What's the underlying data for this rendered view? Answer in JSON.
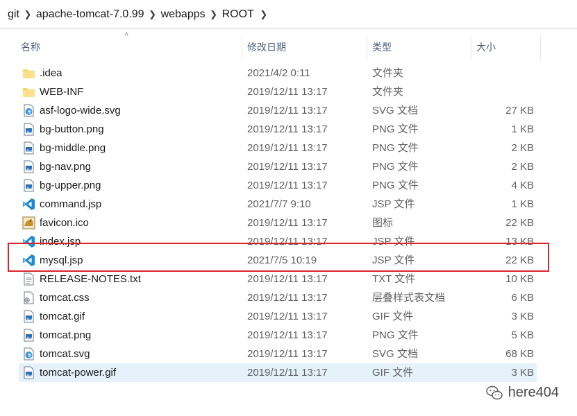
{
  "breadcrumb": [
    "git",
    "apache-tomcat-7.0.99",
    "webapps",
    "ROOT"
  ],
  "columns": {
    "name": "名称",
    "date": "修改日期",
    "type": "类型",
    "size": "大小"
  },
  "files": [
    {
      "name": ".idea",
      "date": "2021/4/2 0:11",
      "type": "文件夹",
      "size": "",
      "icon": "folder-icon"
    },
    {
      "name": "WEB-INF",
      "date": "2019/12/11 13:17",
      "type": "文件夹",
      "size": "",
      "icon": "folder-icon"
    },
    {
      "name": "asf-logo-wide.svg",
      "date": "2019/12/11 13:17",
      "type": "SVG 文档",
      "size": "27 KB",
      "icon": "svg-edge-icon"
    },
    {
      "name": "bg-button.png",
      "date": "2019/12/11 13:17",
      "type": "PNG 文件",
      "size": "1 KB",
      "icon": "image-file-icon"
    },
    {
      "name": "bg-middle.png",
      "date": "2019/12/11 13:17",
      "type": "PNG 文件",
      "size": "2 KB",
      "icon": "image-file-icon"
    },
    {
      "name": "bg-nav.png",
      "date": "2019/12/11 13:17",
      "type": "PNG 文件",
      "size": "2 KB",
      "icon": "image-file-icon"
    },
    {
      "name": "bg-upper.png",
      "date": "2019/12/11 13:17",
      "type": "PNG 文件",
      "size": "4 KB",
      "icon": "image-file-icon"
    },
    {
      "name": "command.jsp",
      "date": "2021/7/7 9:10",
      "type": "JSP 文件",
      "size": "1 KB",
      "icon": "vscode-icon"
    },
    {
      "name": "favicon.ico",
      "date": "2019/12/11 13:17",
      "type": "图标",
      "size": "22 KB",
      "icon": "tomcat-favicon-icon"
    },
    {
      "name": "index.jsp",
      "date": "2019/12/11 13:17",
      "type": "JSP 文件",
      "size": "13 KB",
      "icon": "vscode-icon"
    },
    {
      "name": "mysql.jsp",
      "date": "2021/7/5 10:19",
      "type": "JSP 文件",
      "size": "22 KB",
      "icon": "vscode-icon"
    },
    {
      "name": "RELEASE-NOTES.txt",
      "date": "2019/12/11 13:17",
      "type": "TXT 文件",
      "size": "10 KB",
      "icon": "text-file-icon"
    },
    {
      "name": "tomcat.css",
      "date": "2019/12/11 13:17",
      "type": "层叠样式表文档",
      "size": "6 KB",
      "icon": "css-file-icon"
    },
    {
      "name": "tomcat.gif",
      "date": "2019/12/11 13:17",
      "type": "GIF 文件",
      "size": "3 KB",
      "icon": "image-file-icon"
    },
    {
      "name": "tomcat.png",
      "date": "2019/12/11 13:17",
      "type": "PNG 文件",
      "size": "5 KB",
      "icon": "image-file-icon"
    },
    {
      "name": "tomcat.svg",
      "date": "2019/12/11 13:17",
      "type": "SVG 文档",
      "size": "68 KB",
      "icon": "svg-edge-icon"
    },
    {
      "name": "tomcat-power.gif",
      "date": "2019/12/11 13:17",
      "type": "GIF 文件",
      "size": "3 KB",
      "icon": "image-file-icon",
      "selected": true
    }
  ],
  "highlighted_file": "mysql.jsp",
  "highlight_color": "#d8242b",
  "selection_color": "#e5f1fb",
  "watermark": {
    "text": "here404",
    "icon": "wechat-logo-icon"
  }
}
